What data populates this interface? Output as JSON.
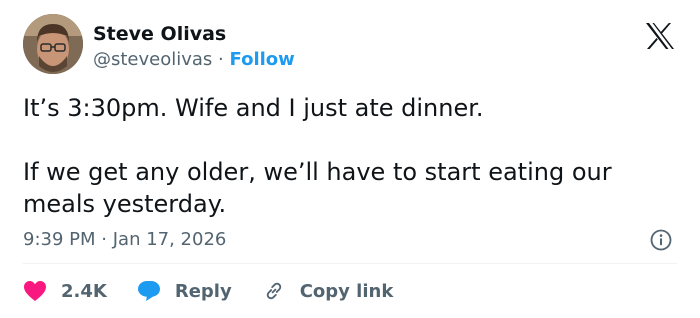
{
  "author": {
    "name": "Steve Olivas",
    "handle": "@steveolivas",
    "separator": "·",
    "follow_label": "Follow"
  },
  "tweet": {
    "text": "It’s 3:30pm. Wife and I just ate dinner.\n\nIf we get any older, we’ll have to start eating our meals yesterday.",
    "time": "9:39 PM",
    "separator": "·",
    "date": "Jan 17, 2026"
  },
  "actions": {
    "like_count": "2.4K",
    "reply_label": "Reply",
    "copy_link_label": "Copy link"
  },
  "icons": {
    "brand": "x-logo-icon",
    "info": "info-icon",
    "like": "heart-icon",
    "reply": "speech-bubble-icon",
    "copy": "link-icon"
  },
  "colors": {
    "link": "#1d9bf0",
    "heart": "#f91880",
    "secondary_text": "#536471"
  }
}
